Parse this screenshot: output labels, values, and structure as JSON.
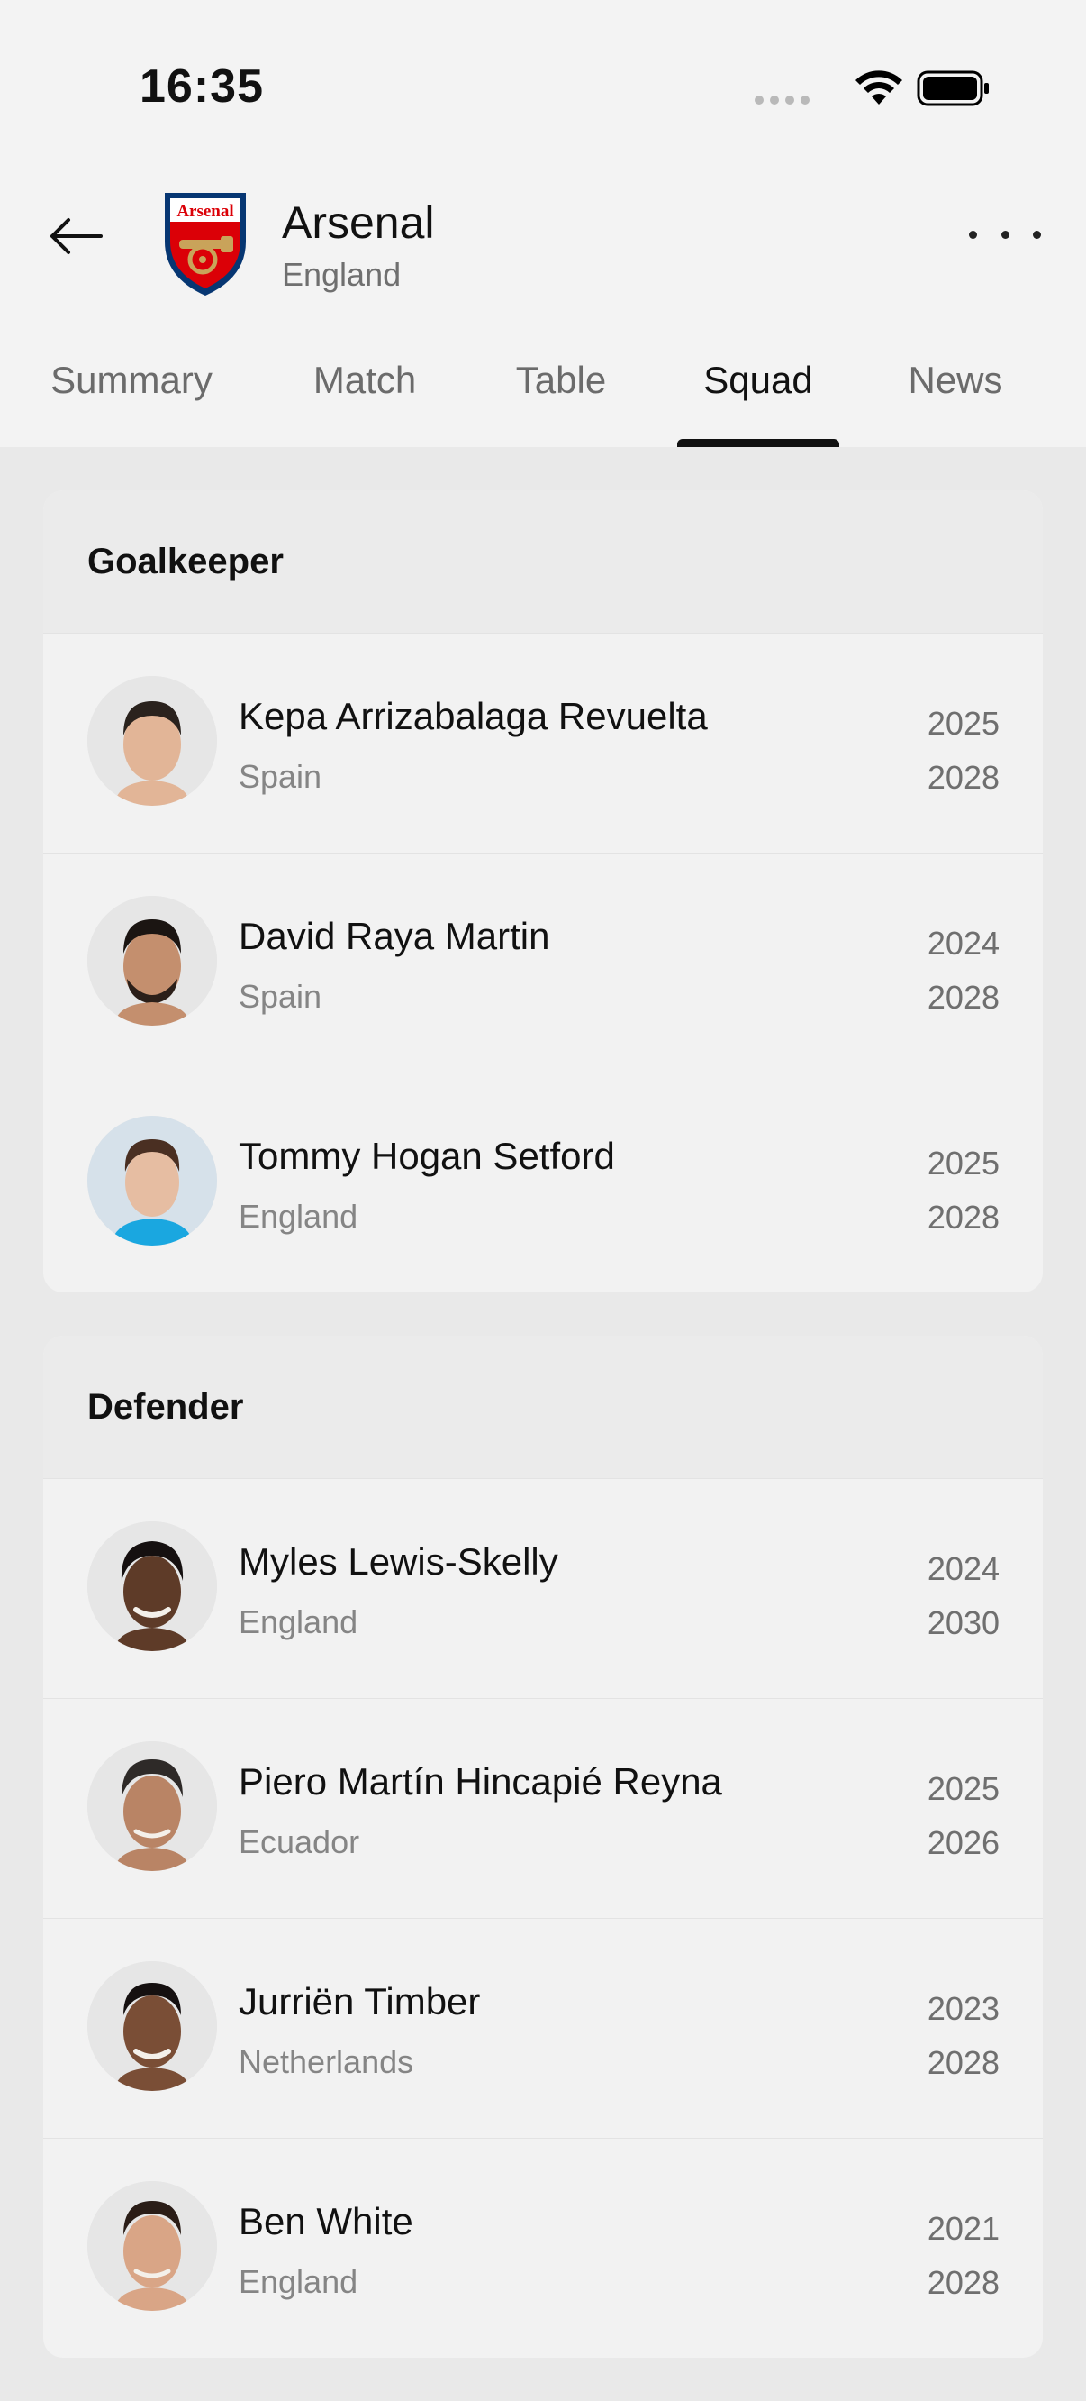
{
  "status_bar": {
    "time": "16:35"
  },
  "header": {
    "club_name": "Arsenal",
    "country": "England",
    "logo_text": "Arsenal"
  },
  "tabs": [
    {
      "label": "Summary",
      "active": false
    },
    {
      "label": "Match",
      "active": false
    },
    {
      "label": "Table",
      "active": false
    },
    {
      "label": "Squad",
      "active": true
    },
    {
      "label": "News",
      "active": false
    }
  ],
  "squad": {
    "goalkeeper": {
      "title": "Goalkeeper",
      "players": [
        {
          "name": "Kepa Arrizabalaga Revuelta",
          "country": "Spain",
          "year_from": "2025",
          "year_to": "2028"
        },
        {
          "name": "David Raya Martin",
          "country": "Spain",
          "year_from": "2024",
          "year_to": "2028"
        },
        {
          "name": "Tommy Hogan Setford",
          "country": "England",
          "year_from": "2025",
          "year_to": "2028"
        }
      ]
    },
    "defender": {
      "title": "Defender",
      "players": [
        {
          "name": "Myles Lewis-Skelly",
          "country": "England",
          "year_from": "2024",
          "year_to": "2030"
        },
        {
          "name": "Piero Martín Hincapié Reyna",
          "country": "Ecuador",
          "year_from": "2025",
          "year_to": "2026"
        },
        {
          "name": "Jurriën Timber",
          "country": "Netherlands",
          "year_from": "2023",
          "year_to": "2028"
        },
        {
          "name": "Ben White",
          "country": "England",
          "year_from": "2021",
          "year_to": "2028"
        }
      ]
    }
  },
  "colors": {
    "accent": "#111111",
    "arsenal_red": "#db0007",
    "arsenal_navy": "#063672",
    "arsenal_gold": "#9c824a"
  }
}
